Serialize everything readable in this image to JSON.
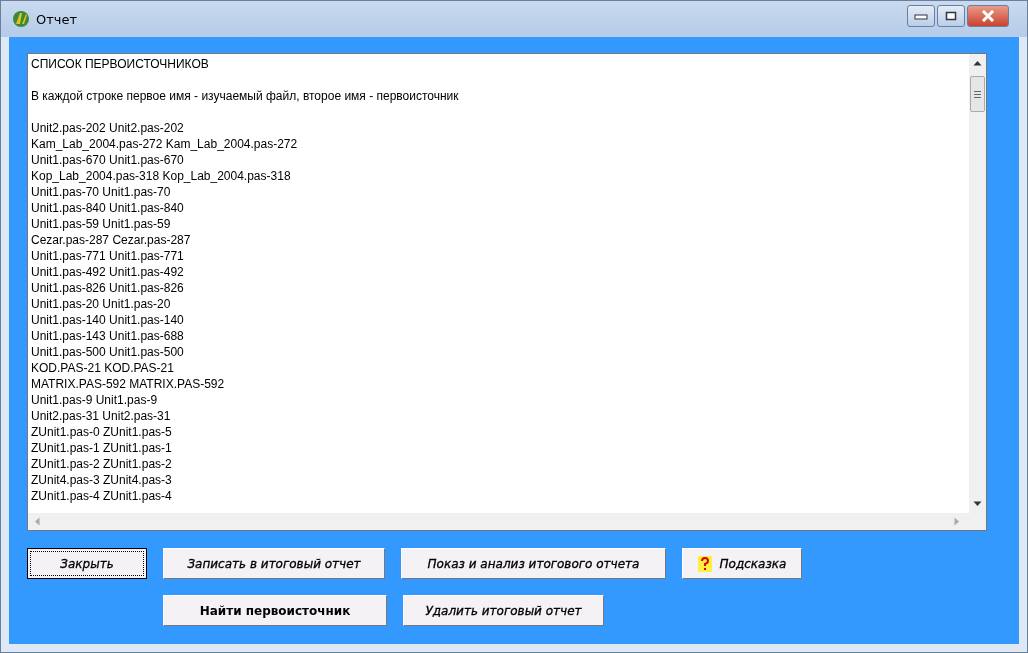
{
  "window": {
    "title": "Отчет"
  },
  "memo": {
    "heading": "СПИСОК ПЕРВОИСТОЧНИКОВ",
    "note": "В каждой строке первое имя - изучаемый файл, второе имя - первоисточник",
    "lines": [
      "Unit2.pas-202 Unit2.pas-202",
      "Kam_Lab_2004.pas-272 Kam_Lab_2004.pas-272",
      "Unit1.pas-670 Unit1.pas-670",
      "Kop_Lab_2004.pas-318 Kop_Lab_2004.pas-318",
      "Unit1.pas-70 Unit1.pas-70",
      "Unit1.pas-840 Unit1.pas-840",
      "Unit1.pas-59 Unit1.pas-59",
      "Cezar.pas-287 Cezar.pas-287",
      "Unit1.pas-771 Unit1.pas-771",
      "Unit1.pas-492 Unit1.pas-492",
      "Unit1.pas-826 Unit1.pas-826",
      "Unit1.pas-20 Unit1.pas-20",
      "Unit1.pas-140 Unit1.pas-140",
      "Unit1.pas-143 Unit1.pas-688",
      "Unit1.pas-500 Unit1.pas-500",
      "KOD.PAS-21 KOD.PAS-21",
      "MATRIX.PAS-592 MATRIX.PAS-592",
      "Unit1.pas-9 Unit1.pas-9",
      "Unit2.pas-31 Unit2.pas-31",
      "ZUnit1.pas-0 ZUnit1.pas-5",
      "ZUnit1.pas-1 ZUnit1.pas-1",
      "ZUnit1.pas-2 ZUnit1.pas-2",
      "ZUnit4.pas-3 ZUnit4.pas-3",
      "ZUnit1.pas-4 ZUnit1.pas-4"
    ]
  },
  "button_rows": [
    [
      {
        "label": "Закрыть",
        "italic": true,
        "focused": true,
        "kind": "plain"
      },
      {
        "label": "Записать в итоговый отчет",
        "italic": true,
        "focused": false,
        "kind": "plain"
      },
      {
        "label": "Показ и анализ итогового  отчета",
        "italic": true,
        "focused": false,
        "kind": "plain"
      },
      {
        "label": "Подсказка",
        "italic": true,
        "focused": false,
        "kind": "help"
      }
    ],
    [
      {
        "label": "Найти первоисточник",
        "italic": false,
        "focused": false,
        "kind": "plain"
      },
      {
        "label": "Удалить итоговый отчет",
        "italic": true,
        "focused": false,
        "kind": "plain"
      }
    ]
  ]
}
